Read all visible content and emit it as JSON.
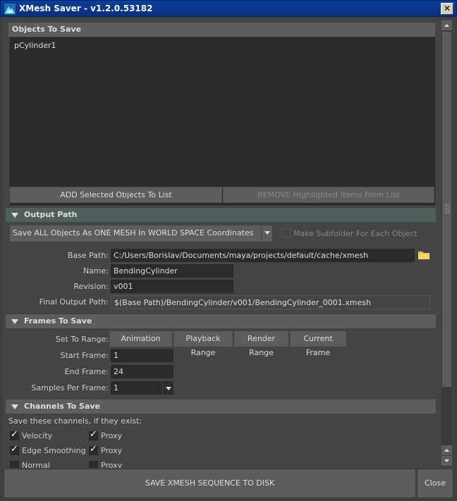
{
  "window": {
    "title": "XMesh Saver - v1.2.0.53182"
  },
  "objects": {
    "header": "Objects To Save",
    "items": [
      "pCylinder1"
    ],
    "add_label": "ADD Selected Objects To List",
    "remove_label": "REMOVE Highlighted Items From List"
  },
  "output": {
    "header": "Output Path",
    "mode_selected": "Save ALL Objects As ONE MESH In WORLD SPACE Coordinates",
    "subfolder_label": "Make Subfolder For Each Object",
    "base_path_label": "Base Path:",
    "base_path": "C:/Users/Borislav/Documents/maya/projects/default/cache/xmesh",
    "name_label": "Name:",
    "name": "BendingCylinder",
    "revision_label": "Revision:",
    "revision": "v001",
    "final_label": "Final Output Path:",
    "final_path": "$(Base Path)/BendingCylinder/v001/BendingCylinder_0001.xmesh"
  },
  "frames": {
    "header": "Frames To Save",
    "set_range_label": "Set To Range:",
    "range_buttons": [
      "Animation Range",
      "Playback Range",
      "Render Range",
      "Current Frame"
    ],
    "start_label": "Start Frame:",
    "start": "1",
    "end_label": "End Frame:",
    "end": "24",
    "samples_label": "Samples Per Frame:",
    "samples": "1"
  },
  "channels": {
    "header": "Channels To Save",
    "intro": "Save these channels, if they exist:",
    "items": [
      {
        "label": "Velocity",
        "checked": true
      },
      {
        "label": "Proxy",
        "checked": true
      },
      {
        "label": "Edge Smoothing",
        "checked": true
      },
      {
        "label": "Proxy",
        "checked": true
      },
      {
        "label": "Normal",
        "checked": false
      },
      {
        "label": "Proxy",
        "checked": false
      }
    ]
  },
  "footer": {
    "save_label": "SAVE XMESH SEQUENCE TO DISK",
    "close_label": "Close"
  },
  "colors": {
    "title_bar": "#0b3f9b",
    "header_bg": "#5d5d5d",
    "teal_header": "#4f5f5c",
    "field_bg": "#2b2b2b"
  }
}
